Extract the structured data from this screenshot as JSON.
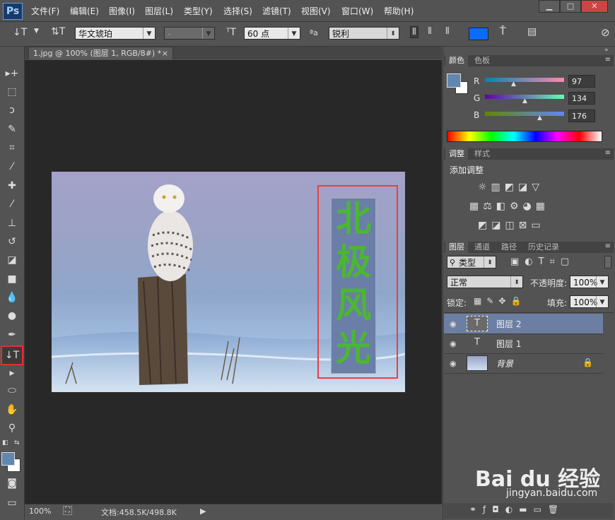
{
  "app": {
    "logo": "Ps"
  },
  "menu": [
    "文件(F)",
    "编辑(E)",
    "图像(I)",
    "图层(L)",
    "类型(Y)",
    "选择(S)",
    "滤镜(T)",
    "视图(V)",
    "窗口(W)",
    "帮助(H)"
  ],
  "window_buttons": {
    "minimize": "▁",
    "maximize": "□",
    "close": "✕"
  },
  "options": {
    "font_family": "华文琥珀",
    "font_style": "-",
    "font_size": "60 点",
    "antialias_label": "ªa",
    "antialias": "锐利",
    "text_color": "#0a6cff"
  },
  "document": {
    "tab_title": "1.jpg @ 100% (图层 1, RGB/8#) *",
    "tab_close": "×",
    "text_chars": [
      "北",
      "极",
      "风",
      "光"
    ],
    "text_color": "#4bb733",
    "highlight_color": "#e84040"
  },
  "status": {
    "zoom": "100%",
    "doc_info": "文档:458.5K/498.8K"
  },
  "color_panel": {
    "tabs": [
      "颜色",
      "色板"
    ],
    "channels": [
      {
        "label": "R",
        "value": "97"
      },
      {
        "label": "G",
        "value": "134"
      },
      {
        "label": "B",
        "value": "176"
      }
    ],
    "foreground": "#6186b0"
  },
  "adjust_panel": {
    "tabs": [
      "调整",
      "样式"
    ],
    "title": "添加调整"
  },
  "layers_panel": {
    "tabs": [
      "图层",
      "通道",
      "路径",
      "历史记录"
    ],
    "filter": "类型",
    "blend_mode": "正常",
    "opacity_label": "不透明度:",
    "opacity": "100%",
    "lock_label": "锁定:",
    "fill_label": "填充:",
    "fill": "100%",
    "layers": [
      {
        "name": "图层 2",
        "type": "text",
        "selected": true
      },
      {
        "name": "图层 1",
        "type": "text",
        "selected": false
      },
      {
        "name": "背景",
        "type": "image",
        "selected": false
      }
    ]
  },
  "watermark": {
    "brand": "Bai du 经验",
    "url": "jingyan.baidu.com"
  }
}
